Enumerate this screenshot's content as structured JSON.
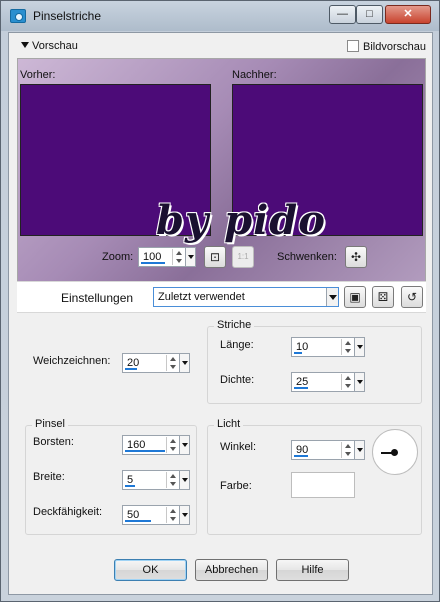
{
  "window": {
    "title": "Pinselstriche"
  },
  "titlebar_buttons": {
    "minimize": "—",
    "maximize": "□",
    "close": "✕"
  },
  "preview": {
    "toggle_label": "Vorschau",
    "bildvorschau_label": "Bildvorschau",
    "bildvorschau_checked": false,
    "before_label": "Vorher:",
    "after_label": "Nachher:",
    "zoom_label": "Zoom:",
    "zoom_value": "100",
    "pan_label": "Schwenken:",
    "watermark_text": "by pido"
  },
  "settings": {
    "label": "Einstellungen",
    "preset_value": "Zuletzt verwendet"
  },
  "fields": {
    "weichzeichnen": {
      "label": "Weichzeichnen:",
      "value": "20"
    },
    "striche_title": "Striche",
    "laenge": {
      "label": "Länge:",
      "value": "10"
    },
    "dichte": {
      "label": "Dichte:",
      "value": "25"
    },
    "pinsel_title": "Pinsel",
    "borsten": {
      "label": "Borsten:",
      "value": "160"
    },
    "breite": {
      "label": "Breite:",
      "value": "5"
    },
    "deckfaehigkeit": {
      "label": "Deckfähigkeit:",
      "value": "50"
    },
    "licht_title": "Licht",
    "winkel": {
      "label": "Winkel:",
      "value": "90"
    },
    "farbe": {
      "label": "Farbe:",
      "color": "#ffffff"
    }
  },
  "buttons": {
    "ok": "OK",
    "cancel": "Abbrechen",
    "help": "Hilfe"
  },
  "colors": {
    "preview_bg": "#4c0b78",
    "accent": "#1e78d6"
  }
}
